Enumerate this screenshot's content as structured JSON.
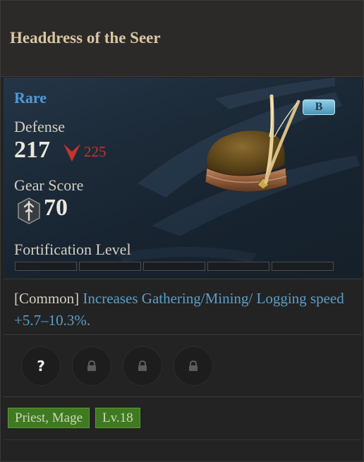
{
  "item": {
    "name": "Headdress of the Seer",
    "rarity": "Rare",
    "grade": "B"
  },
  "stats": {
    "defense_label": "Defense",
    "defense_value": "217",
    "defense_compare": "225",
    "gear_score_label": "Gear Score",
    "gear_score_value": "70",
    "fortification_label": "Fortification Level",
    "fortification_level": 0,
    "fortification_max": 5
  },
  "effect": {
    "tag": "[Common]",
    "text": "Increases Gathering/Mining/ Logging speed +5.7–10.3%."
  },
  "slots": [
    {
      "state": "unknown",
      "icon": "question-icon",
      "glyph": "?"
    },
    {
      "state": "locked",
      "icon": "lock-icon"
    },
    {
      "state": "locked",
      "icon": "lock-icon"
    },
    {
      "state": "locked",
      "icon": "lock-icon"
    }
  ],
  "requirements": {
    "classes": "Priest, Mage",
    "level": "Lv.18"
  },
  "colors": {
    "rarity": "#4f9ad8",
    "decrease": "#c8332d",
    "effect_text": "#5a9fcb",
    "requirement_bg": "#3f7a22"
  }
}
